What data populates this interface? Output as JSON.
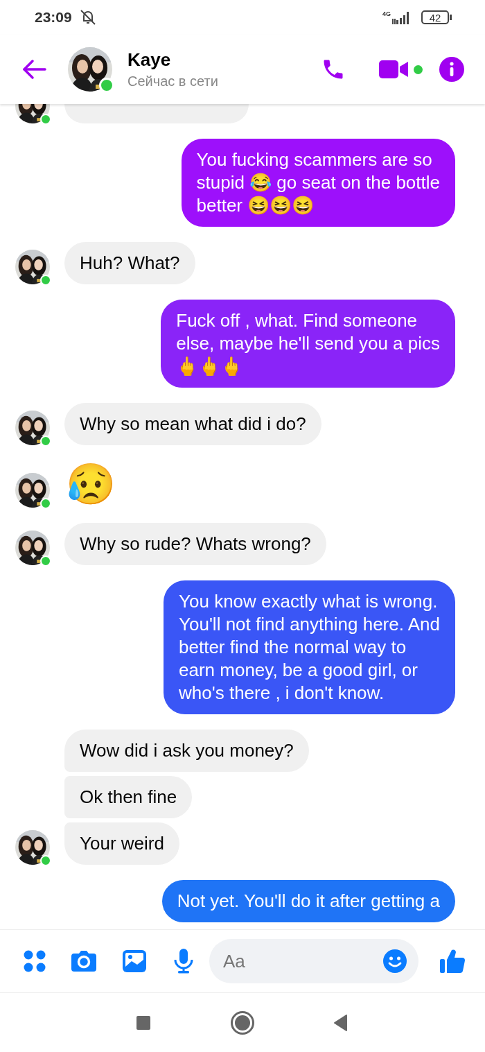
{
  "status_bar": {
    "time": "23:09",
    "network": "4G",
    "battery": "42"
  },
  "header": {
    "name": "Kaye",
    "status": "Сейчас в сети",
    "online": true
  },
  "messages": [
    {
      "kind": "hidden",
      "avatar": true
    },
    {
      "kind": "sent",
      "color": "#9d10fb",
      "lines": [
        "You fucking scammers are so",
        "stupid 😂 go seat on the bottle",
        "better 😆😆😆"
      ]
    },
    {
      "kind": "received",
      "avatar": true,
      "lines": [
        "Huh? What?"
      ]
    },
    {
      "kind": "sent",
      "color": "#8a24f8",
      "lines": [
        "Fuck off , what. Find someone",
        "else, maybe he'll send you a pics",
        "🖕🖕🖕"
      ]
    },
    {
      "kind": "received",
      "avatar": true,
      "lines": [
        "Why so mean what did i do?"
      ]
    },
    {
      "kind": "emoji",
      "avatar": true,
      "lines": [
        "😥"
      ]
    },
    {
      "kind": "received",
      "avatar": true,
      "lines": [
        "Why so rude? Whats wrong?"
      ]
    },
    {
      "kind": "sent",
      "color": "#3a56f6",
      "lines": [
        "You know exactly what is wrong.",
        "You'll not find anything here. And",
        "better find the normal way to",
        "earn money, be a good girl, or",
        "who's there , i don't know."
      ]
    },
    {
      "kind": "received",
      "avatar": false,
      "grouped": true,
      "lines": [
        "Wow did i ask you money?"
      ]
    },
    {
      "kind": "received",
      "avatar": false,
      "grouped": true,
      "lines": [
        "Ok then fine"
      ]
    },
    {
      "kind": "received",
      "avatar": true,
      "grouped": true,
      "lines": [
        "Your weird"
      ]
    },
    {
      "kind": "sent",
      "color": "#1f74f6",
      "lines": [
        "Not yet. You'll do it after getting a"
      ]
    }
  ],
  "composer": {
    "placeholder": "Aa"
  }
}
